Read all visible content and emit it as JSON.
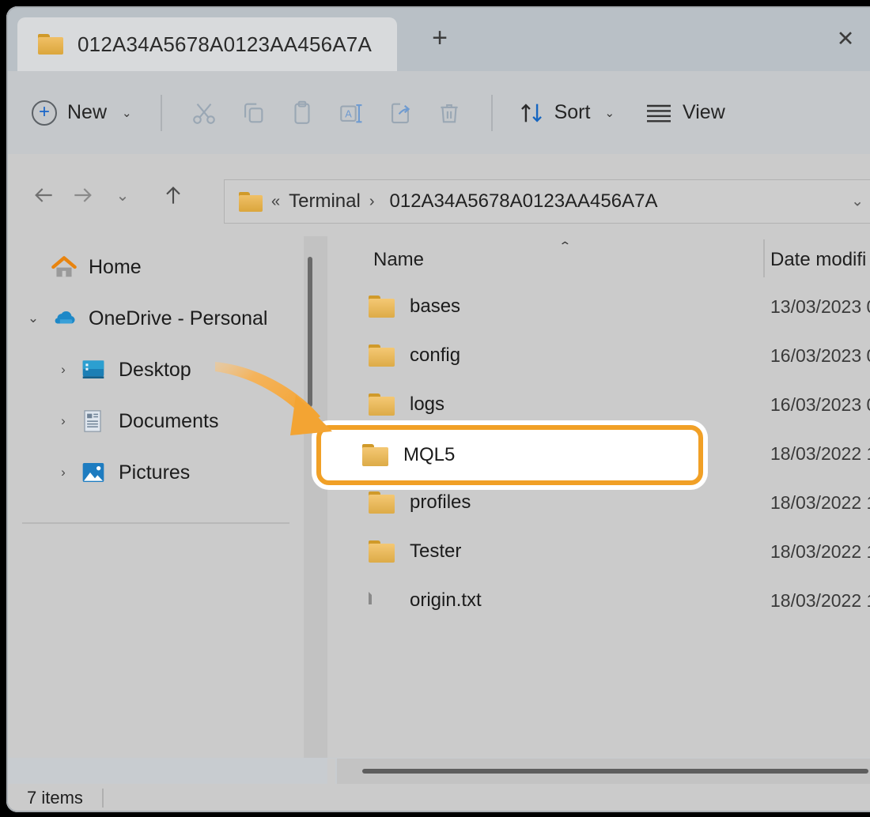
{
  "window": {
    "tab": {
      "title": "012A34A5678A0123AA456A7A",
      "close_label": "✕",
      "newtab_label": "+"
    }
  },
  "toolbar": {
    "new_label": "New",
    "new_caret": "⌄",
    "sort_label": "Sort",
    "sort_caret": "⌄",
    "view_label": "View",
    "icons": [
      "cut-icon",
      "copy-icon",
      "paste-icon",
      "rename-icon",
      "share-icon",
      "delete-icon"
    ]
  },
  "addressbar": {
    "back": "←",
    "forward": "→",
    "recent_caret": "⌄",
    "up": "↑",
    "crumb_prefix": "«",
    "crumb_parent": "Terminal",
    "crumb_sep": "›",
    "crumb_current": "012A34A5678A0123AA456A7A",
    "dropdown_caret": "⌄"
  },
  "sidebar": {
    "items": [
      {
        "label": "Home",
        "icon": "home-icon",
        "expander": "",
        "indent": 0
      },
      {
        "label": "OneDrive - Personal",
        "icon": "onedrive-icon",
        "expander": "⌄",
        "indent": 0
      },
      {
        "label": "Desktop",
        "icon": "desktop-icon",
        "expander": "›",
        "indent": 1
      },
      {
        "label": "Documents",
        "icon": "documents-icon",
        "expander": "›",
        "indent": 1
      },
      {
        "label": "Pictures",
        "icon": "pictures-icon",
        "expander": "›",
        "indent": 1
      }
    ]
  },
  "filelist": {
    "columns": {
      "name": "Name",
      "date_modified": "Date modifi",
      "sort_caret": "⌃"
    },
    "rows": [
      {
        "name": "bases",
        "type": "folder",
        "date": "13/03/2023 0"
      },
      {
        "name": "config",
        "type": "folder",
        "date": "16/03/2023 0"
      },
      {
        "name": "logs",
        "type": "folder",
        "date": "16/03/2023 0"
      },
      {
        "name": "MQL5",
        "type": "folder",
        "date": "18/03/2022 1",
        "highlighted": true
      },
      {
        "name": "profiles",
        "type": "folder",
        "date": "18/03/2022 1"
      },
      {
        "name": "Tester",
        "type": "folder",
        "date": "18/03/2022 1"
      },
      {
        "name": "origin.txt",
        "type": "file",
        "date": "18/03/2022 1"
      }
    ]
  },
  "statusbar": {
    "item_count": "7 items"
  },
  "annotation": {
    "highlight_target": "MQL5",
    "arrow_color": "#f5a945",
    "highlight_color": "#f1a026"
  }
}
